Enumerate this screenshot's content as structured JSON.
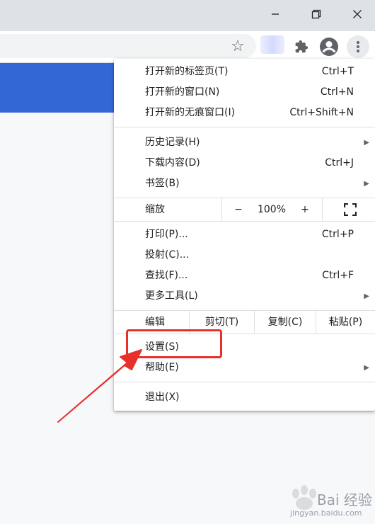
{
  "window": {
    "minimize": "—",
    "maximize": "❐",
    "close": "✕"
  },
  "toolbar": {
    "star": "☆"
  },
  "menu": {
    "items": [
      {
        "label": "打开新的标签页(T)",
        "shortcut": "Ctrl+T"
      },
      {
        "label": "打开新的窗口(N)",
        "shortcut": "Ctrl+N"
      },
      {
        "label": "打开新的无痕窗口(I)",
        "shortcut": "Ctrl+Shift+N"
      },
      {
        "label": "历史记录(H)"
      },
      {
        "label": "下载内容(D)",
        "shortcut": "Ctrl+J"
      },
      {
        "label": "书签(B)"
      },
      {
        "label": "打印(P)...",
        "shortcut": "Ctrl+P"
      },
      {
        "label": "投射(C)..."
      },
      {
        "label": "查找(F)...",
        "shortcut": "Ctrl+F"
      },
      {
        "label": "更多工具(L)"
      },
      {
        "label": "设置(S)"
      },
      {
        "label": "帮助(E)"
      },
      {
        "label": "退出(X)"
      }
    ],
    "zoom": {
      "label": "缩放",
      "minus": "−",
      "value": "100%",
      "plus": "+"
    },
    "edit": {
      "label": "编辑",
      "cut": "剪切(T)",
      "copy": "复制(C)",
      "paste": "粘贴(P)"
    }
  },
  "watermark": {
    "text": "Bai 经验",
    "sub": "jingyan.baidu.com"
  }
}
